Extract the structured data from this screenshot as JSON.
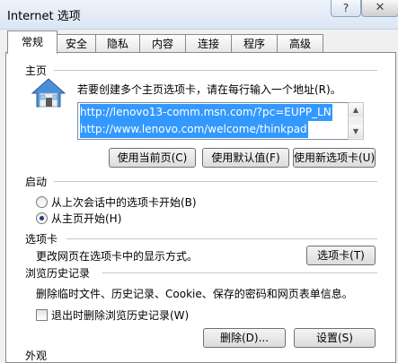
{
  "window": {
    "title": "Internet 选项",
    "help_glyph": "?",
    "close_glyph": "✕"
  },
  "tabs": [
    "常规",
    "安全",
    "隐私",
    "内容",
    "连接",
    "程序",
    "高级"
  ],
  "homepage": {
    "section_label": "主页",
    "description": "若要创建多个主页选项卡，请在每行输入一个地址(R)。",
    "urls": [
      "http://lenovo13-comm.msn.com/?pc=EUPP_LN",
      "http://www.lenovo.com/welcome/thinkpad"
    ],
    "buttons": {
      "use_current": "使用当前页(C)",
      "use_default": "使用默认值(F)",
      "use_new_tab": "使用新选项卡(U)"
    }
  },
  "startup": {
    "section_label": "启动",
    "options": [
      {
        "label": "从上次会话中的选项卡开始(B)",
        "selected": false
      },
      {
        "label": "从主页开始(H)",
        "selected": true
      }
    ]
  },
  "tabs_section": {
    "section_label": "选项卡",
    "description": "更改网页在选项卡中的显示方式。",
    "button": "选项卡(T)"
  },
  "history": {
    "section_label": "浏览历史记录",
    "description": "删除临时文件、历史记录、Cookie、保存的密码和网页表单信息。",
    "checkbox_label": "退出时删除浏览历史记录(W)",
    "checkbox_checked": false,
    "delete_button": "删除(D)...",
    "settings_button": "设置(S)"
  },
  "appearance": {
    "section_label": "外观"
  },
  "colors": {
    "selection": "#3399ff",
    "panel": "#ffffff",
    "window": "#f0f0f0"
  }
}
